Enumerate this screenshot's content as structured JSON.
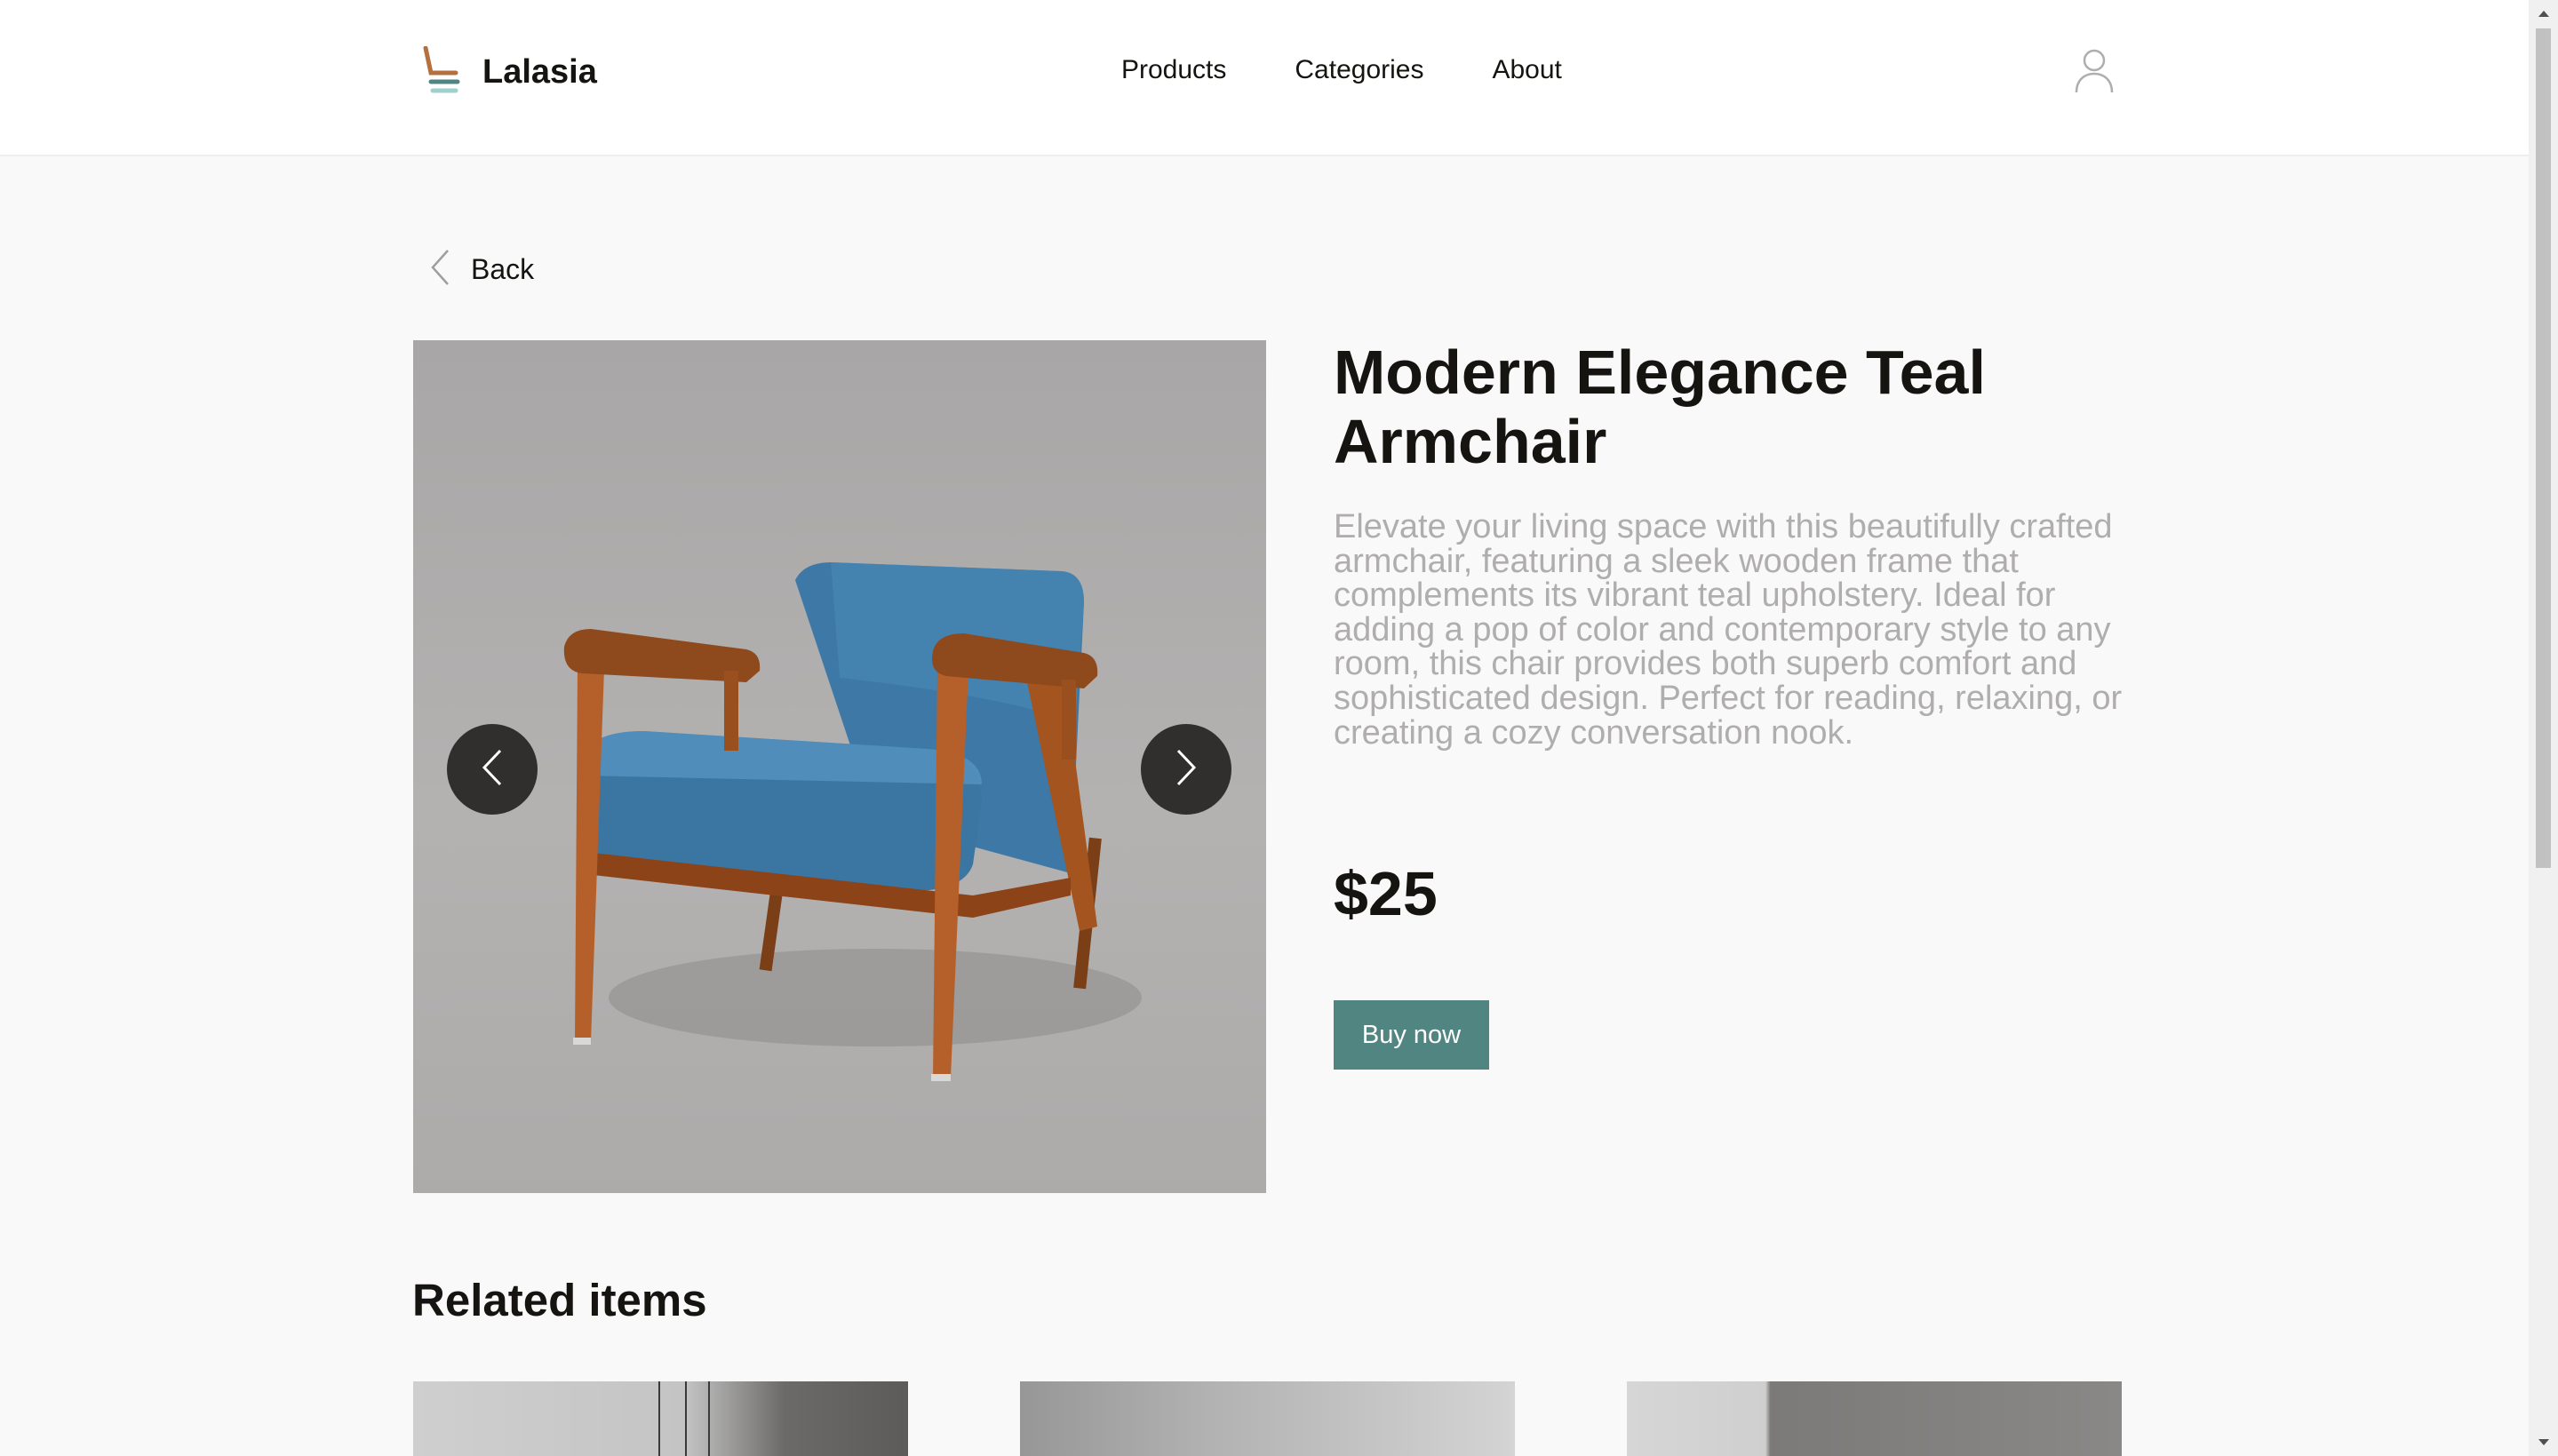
{
  "brand": {
    "name": "Lalasia"
  },
  "nav": {
    "items": [
      "Products",
      "Categories",
      "About"
    ]
  },
  "back": {
    "label": "Back"
  },
  "product": {
    "title": "Modern Elegance Teal Armchair",
    "description": "Elevate your living space with this beautifully crafted armchair, featuring a sleek wooden frame that complements its vibrant teal upholstery. Ideal for adding a pop of color and contemporary style to any room, this chair provides both superb comfort and sophisticated design. Perfect for reading, relaxing, or creating a cozy conversation nook.",
    "price": "$25",
    "buy_label": "Buy now"
  },
  "related": {
    "title": "Related items"
  },
  "colors": {
    "accent": "#518581",
    "text": "#151411",
    "muted": "#afadad",
    "background": "#f9f9f9"
  },
  "icons": {
    "logo": "chair-logo-icon",
    "user": "user-icon",
    "back": "chevron-left-icon",
    "prev": "chevron-left-icon",
    "next": "chevron-right-icon"
  }
}
